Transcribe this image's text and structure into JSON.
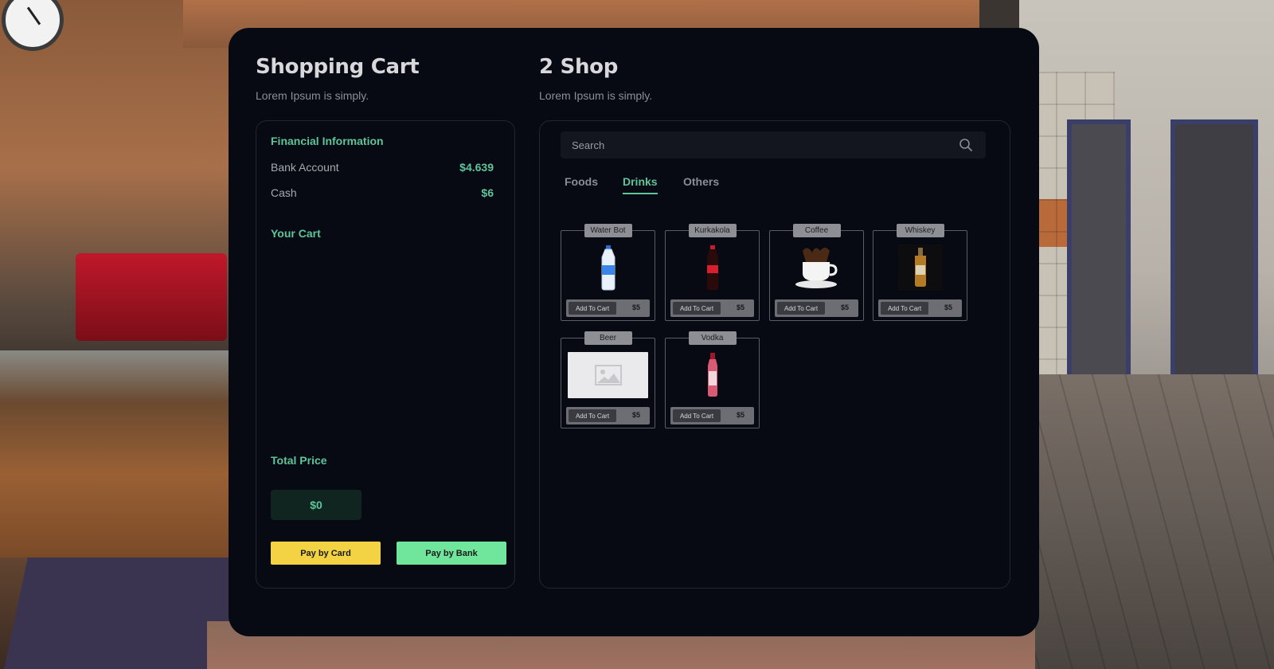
{
  "cart": {
    "title": "Shopping Cart",
    "subtitle": "Lorem Ipsum is simply.",
    "financial_title": "Financial Information",
    "bank_label": "Bank Account",
    "bank_value": "$4.639",
    "cash_label": "Cash",
    "cash_value": "$6",
    "your_cart_title": "Your Cart",
    "total_title": "Total Price",
    "total_value": "$0",
    "pay_card_label": "Pay by Card",
    "pay_bank_label": "Pay by Bank"
  },
  "shop": {
    "title": "2 Shop",
    "subtitle": "Lorem Ipsum is simply.",
    "search_placeholder": "Search",
    "tabs": [
      {
        "label": "Foods",
        "active": false
      },
      {
        "label": "Drinks",
        "active": true
      },
      {
        "label": "Others",
        "active": false
      }
    ],
    "items": [
      {
        "name": "Water Bot",
        "add_label": "Add To Cart",
        "price": "$5",
        "icon": "water-bottle-icon"
      },
      {
        "name": "Kurkakola",
        "add_label": "Add To Cart",
        "price": "$5",
        "icon": "cola-bottle-icon"
      },
      {
        "name": "Coffee",
        "add_label": "Add To Cart",
        "price": "$5",
        "icon": "coffee-cup-icon"
      },
      {
        "name": "Whiskey",
        "add_label": "Add To Cart",
        "price": "$5",
        "icon": "whiskey-bottle-icon"
      },
      {
        "name": "Beer",
        "add_label": "Add To Cart",
        "price": "$5",
        "icon": "image-placeholder-icon"
      },
      {
        "name": "Vodka",
        "add_label": "Add To Cart",
        "price": "$5",
        "icon": "vodka-bottle-icon"
      }
    ]
  },
  "colors": {
    "accent": "#5ec49a",
    "panel_bg": "#070a12",
    "card_button": "#f3d243",
    "bank_button": "#6fe69c"
  }
}
